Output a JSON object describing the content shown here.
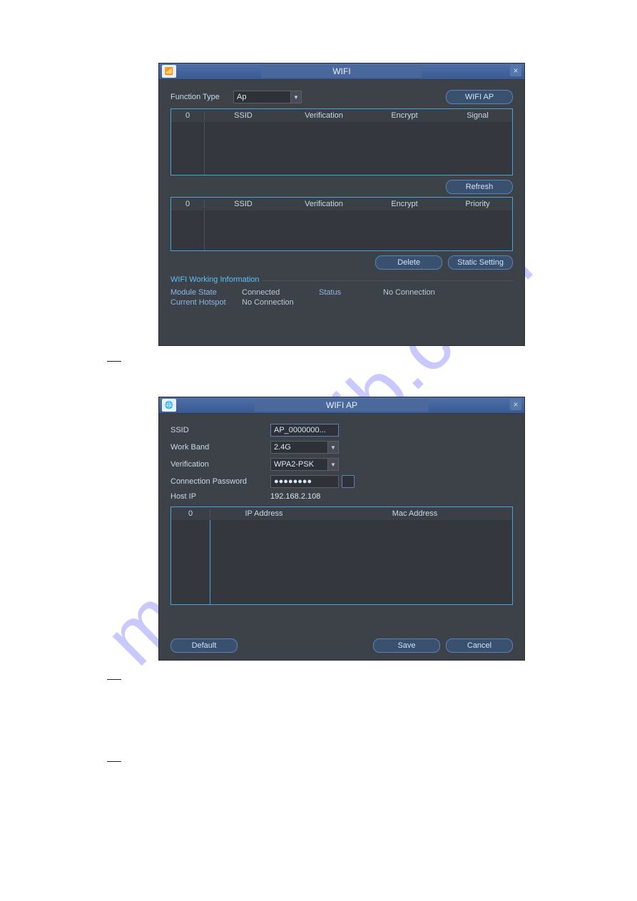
{
  "watermark": "manualslib.com",
  "dialog1": {
    "title": "WIFI",
    "functionTypeLabel": "Function Type",
    "functionTypeValue": "Ap",
    "wifiApBtn": "WIFI AP",
    "grid1": {
      "c0": "0",
      "c1": "SSID",
      "c2": "Verification",
      "c3": "Encrypt",
      "c4": "Signal"
    },
    "refreshBtn": "Refresh",
    "grid2": {
      "c0": "0",
      "c1": "SSID",
      "c2": "Verification",
      "c3": "Encrypt",
      "c4": "Priority"
    },
    "deleteBtn": "Delete",
    "staticBtn": "Static Setting",
    "section": "WIFI Working Information",
    "moduleStateLbl": "Module State",
    "moduleStateVal": "Connected",
    "statusLbl": "Status",
    "statusVal": "No Connection",
    "hotspotLbl": "Current Hotspot",
    "hotspotVal": "No Connection"
  },
  "dialog2": {
    "title": "WIFI AP",
    "ssidLbl": "SSID",
    "ssidVal": "AP_0000000...",
    "workBandLbl": "Work Band",
    "workBandVal": "2.4G",
    "verificationLbl": "Verification",
    "verificationVal": "WPA2-PSK",
    "passwordLbl": "Connection Password",
    "passwordVal": "●●●●●●●●",
    "hostIpLbl": "Host IP",
    "hostIpVal": "192.168.2.108",
    "grid": {
      "c0": "0",
      "c1": "IP Address",
      "c2": "Mac Address"
    },
    "defaultBtn": "Default",
    "saveBtn": "Save",
    "cancelBtn": "Cancel"
  }
}
